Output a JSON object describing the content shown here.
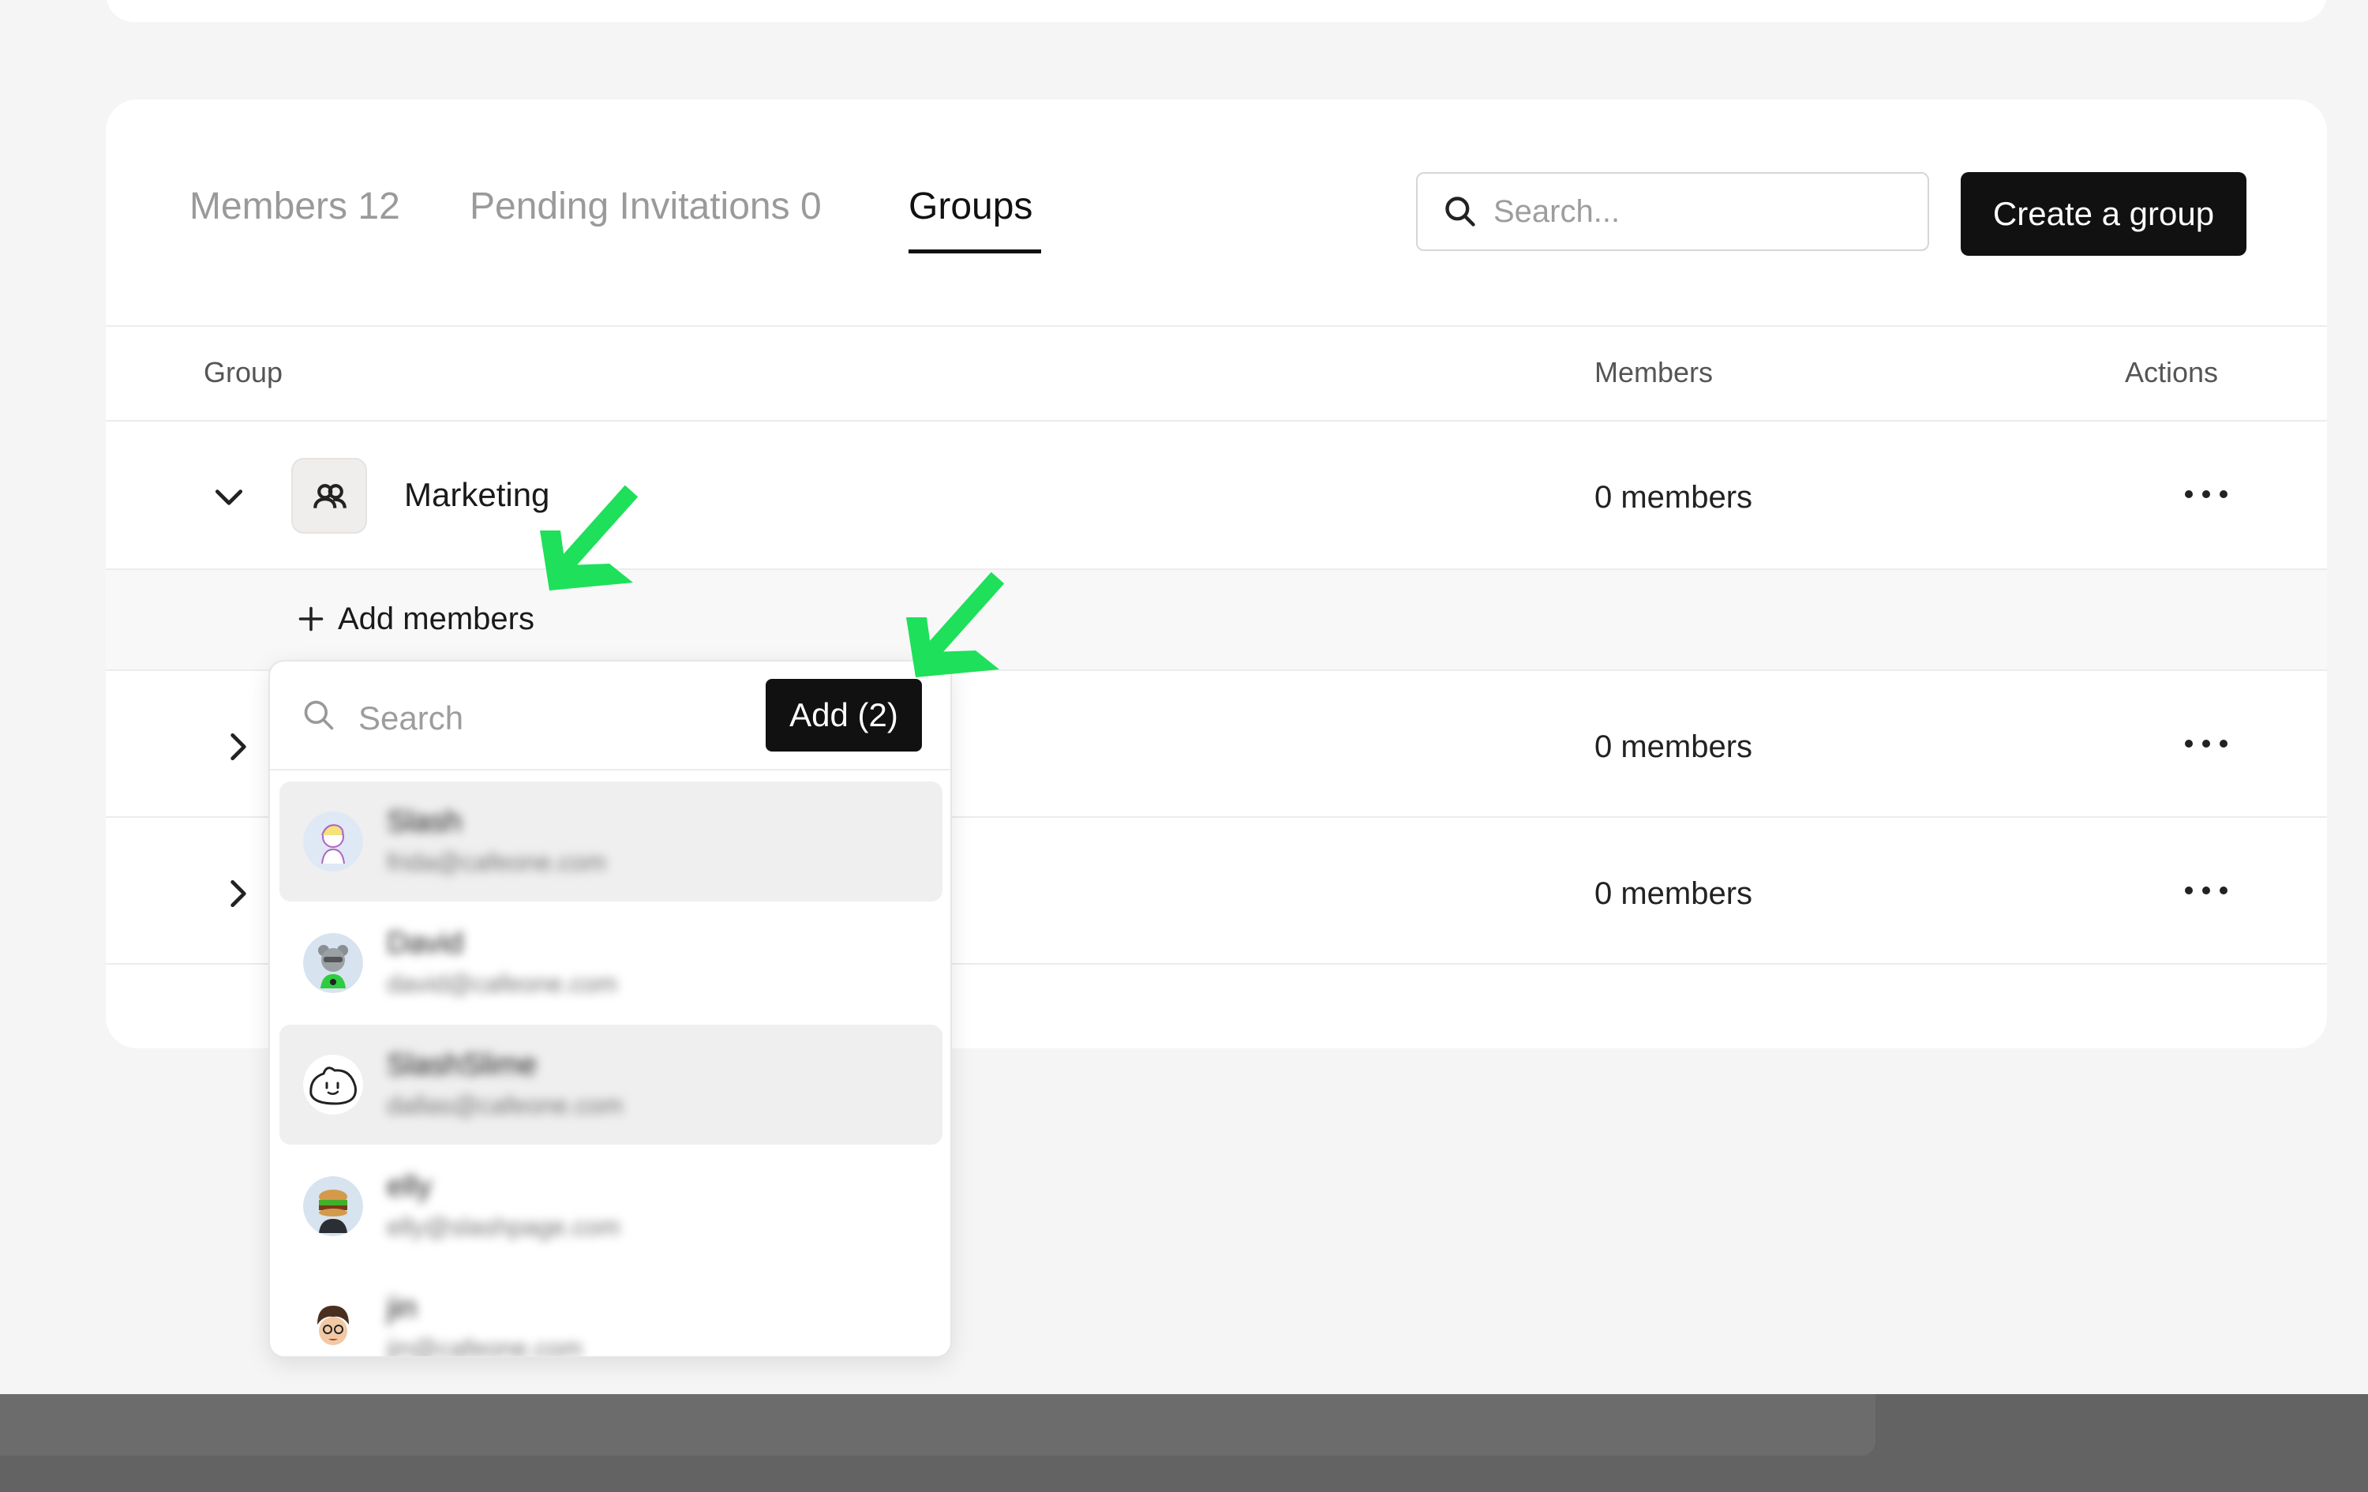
{
  "tabs": [
    {
      "label": "Members 12",
      "active": false
    },
    {
      "label": "Pending Invitations 0",
      "active": false
    },
    {
      "label": "Groups",
      "active": true
    }
  ],
  "search": {
    "placeholder": "Search..."
  },
  "create_group_label": "Create a group",
  "table": {
    "headers": {
      "group": "Group",
      "members": "Members",
      "actions": "Actions"
    },
    "rows": [
      {
        "name": "Marketing",
        "members": "0 members",
        "expanded": true
      },
      {
        "name": "",
        "members": "0 members",
        "expanded": false
      },
      {
        "name": "",
        "members": "0 members",
        "expanded": false
      }
    ]
  },
  "add_members_label": "Add members",
  "picker": {
    "search_placeholder": "Search",
    "add_button": "Add (2)",
    "users": [
      {
        "name": "Slash",
        "email": "frida@cafeone.com",
        "selected": true
      },
      {
        "name": "David",
        "email": "david@cafeone.com",
        "selected": false
      },
      {
        "name": "SlashSlime",
        "email": "dallas@cafeone.com",
        "selected": true
      },
      {
        "name": "elly",
        "email": "elly@slashpage.com",
        "selected": false
      },
      {
        "name": "jin",
        "email": "jin@cafeone.com",
        "selected": false
      }
    ]
  },
  "colors": {
    "accent": "#111111",
    "annotation_arrow": "#1ee05a",
    "selected_row": "#efefef"
  }
}
